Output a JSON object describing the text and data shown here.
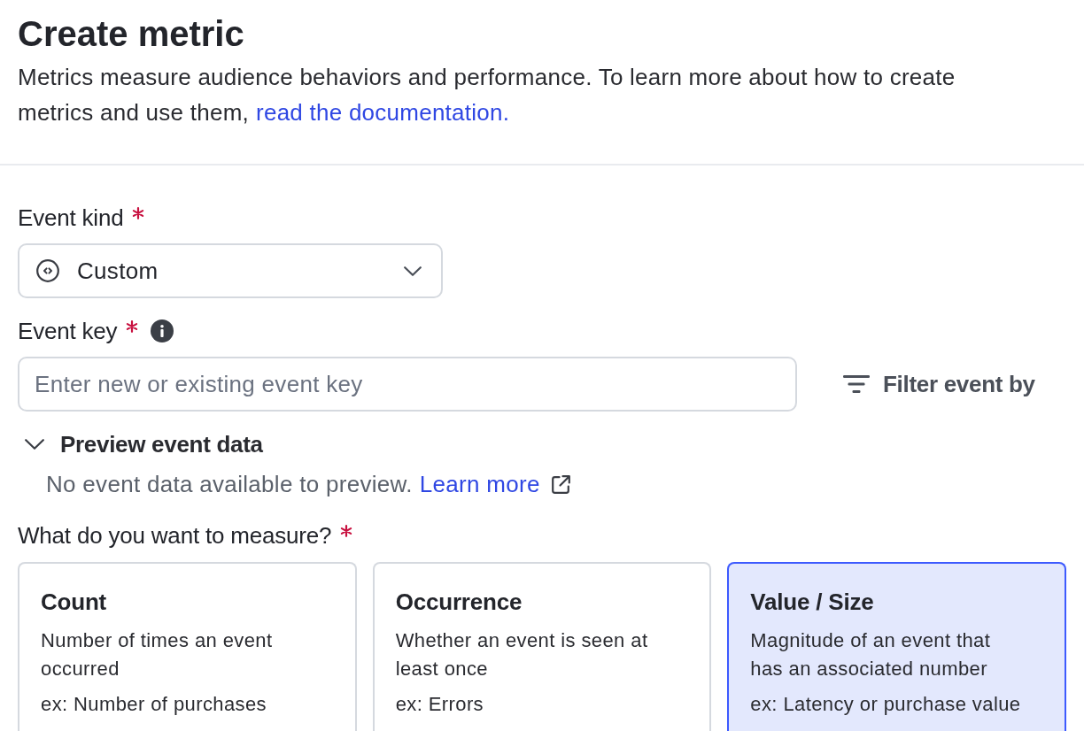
{
  "header": {
    "title": "Create metric",
    "description": "Metrics measure audience behaviors and performance. To learn more about how to create metrics and use them,",
    "link": "read the documentation."
  },
  "event_kind": {
    "label": "Event kind",
    "required": true,
    "value": "Custom"
  },
  "event_key": {
    "label": "Event key",
    "required": true,
    "placeholder": "Enter new or existing event key",
    "filter_button": "Filter event by"
  },
  "preview": {
    "title": "Preview event data",
    "expanded": true,
    "message": "No event data available to preview.",
    "link": "Learn more"
  },
  "measure": {
    "label": "What do you want to measure?",
    "required": true,
    "options": [
      {
        "title": "Count",
        "description": "Number of times an event occurred",
        "example": "ex: Number of purchases",
        "selected": false
      },
      {
        "title": "Occurrence",
        "description": "Whether an event is seen at least once",
        "example": "ex: Errors",
        "selected": false
      },
      {
        "title": "Value / Size",
        "description": "Magnitude of an event that has an associated number",
        "example": "ex: Latency or purchase value",
        "selected": true
      }
    ]
  }
}
